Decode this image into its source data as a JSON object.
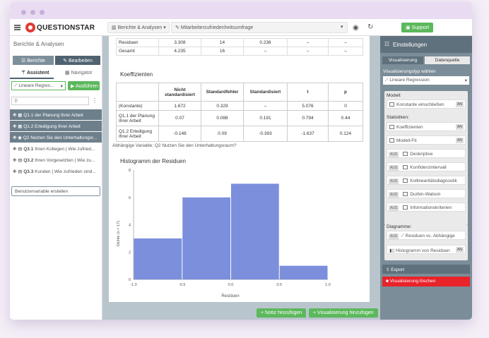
{
  "app": {
    "brand": "QUESTIONSTAR"
  },
  "topbar": {
    "crumb1": "Berichte & Analysen",
    "crumb2": "Mitarbeiterzufriedenheitsumfrage",
    "support": "Support"
  },
  "left": {
    "title": "Berichte & Analysen",
    "btn_reports": "Berichte",
    "btn_edit": "Bearbeiten",
    "tab_assistant": "Assistent",
    "tab_navigator": "Navigator",
    "method": "Lineare Regres...",
    "run": "Ausführen",
    "search_placeholder": "",
    "variables": [
      {
        "code": "Q1.1",
        "label": "der Planung Ihrer Arbeit"
      },
      {
        "code": "Q1.2",
        "label": "Erledigung Ihrer Arbeit"
      },
      {
        "code": "Q2",
        "label": "Nutzen Sie den Unterhaltungsr..."
      },
      {
        "code": "Q3.1",
        "label": "Ihren Kollegen | Wie zufried..."
      },
      {
        "code": "Q3.2",
        "label": "Ihren Vorgesetzten | Wie zu..."
      },
      {
        "code": "Q3.3",
        "label": "Kunden | Wie zufrieden sind..."
      }
    ],
    "create_var": "Benutzervariable erstellen"
  },
  "anova": {
    "rows": [
      {
        "label": "Residuen",
        "ss": "3.308",
        "df": "14",
        "ms": "0.236",
        "f": "–",
        "p": "–"
      },
      {
        "label": "Gesamt",
        "ss": "4.235",
        "df": "16",
        "ms": "–",
        "f": "–",
        "p": "–"
      }
    ]
  },
  "coef": {
    "title": "Koeffizienten",
    "headers": {
      "b": "Nicht standardisiert",
      "se": "Standardfehler",
      "beta": "Standardisiert",
      "t": "t",
      "p": "p"
    },
    "rows": [
      {
        "label": "(Konstante)",
        "b": "1.672",
        "se": "0.329",
        "beta": "–",
        "t": "5.076",
        "p": "0"
      },
      {
        "label": "Q1.1 der Planung Ihrer Arbeit",
        "b": "0.07",
        "se": "0.088",
        "beta": "0.191",
        "t": "0.794",
        "p": "0.44"
      },
      {
        "label": "Q1.2 Erledigung Ihrer Arbeit",
        "b": "-0.148",
        "se": "0.09",
        "beta": "-0.393",
        "t": "-1.637",
        "p": "0.124"
      }
    ],
    "dependent": "Abhängige Variable: Q2 Nutzen Sie den Unterhaltungsraum?"
  },
  "chart_data": {
    "type": "bar",
    "title": "Histogramm der Residuen",
    "xlabel": "Residuen",
    "ylabel": "Dichte (n = 17)",
    "xlim": [
      -1.0,
      1.0
    ],
    "ylim": [
      0,
      8
    ],
    "x_ticks": [
      "-1.0",
      "-0.5",
      "0.0",
      "0.5",
      "1.0"
    ],
    "y_ticks": [
      "0",
      "2",
      "4",
      "6",
      "8"
    ],
    "bins": [
      {
        "x0": -1.0,
        "x1": -0.5,
        "value": 3
      },
      {
        "x0": -0.5,
        "x1": 0.0,
        "value": 6
      },
      {
        "x0": 0.0,
        "x1": 0.5,
        "value": 7
      },
      {
        "x0": 0.5,
        "x1": 1.0,
        "value": 1
      }
    ],
    "color": "#7b8fdc"
  },
  "footer": {
    "add_note": "Notiz hinzufügen",
    "add_vis": "Visualisierung hinzufügen"
  },
  "right": {
    "title": "Einstellungen",
    "tab_vis": "Visualisierung",
    "tab_data": "Datenquelle",
    "vistype_label": "Visualisierungstyp wählen",
    "vistype": "Lineare Regression",
    "model_label": "Modell:",
    "model_items": [
      {
        "label": "Konstante einschließen",
        "badge": "AN"
      }
    ],
    "stats_label": "Statistiken:",
    "stats_items": [
      {
        "label": "Koeffizienten",
        "badge": "AN",
        "pos": "right"
      },
      {
        "label": "Modell-Fit",
        "badge": "AN",
        "pos": "right"
      },
      {
        "label": "Deskriptive",
        "badge": "AUS",
        "pos": "left"
      },
      {
        "label": "Konfidenzintervall",
        "badge": "AUS",
        "pos": "left"
      },
      {
        "label": "Kollinearitätsdiagnostik",
        "badge": "AUS",
        "pos": "left"
      },
      {
        "label": "Durbin-Watson",
        "badge": "AUS",
        "pos": "left"
      },
      {
        "label": "Informationskriterien",
        "badge": "AUS",
        "pos": "left"
      }
    ],
    "diag_label": "Diagramme:",
    "diag_items": [
      {
        "label": "Residuen vs. Abhängige",
        "badge": "AUS",
        "pos": "left"
      },
      {
        "label": "Histogramm von Residuen",
        "badge": "AN",
        "pos": "right"
      }
    ],
    "export": "Export",
    "delete": "Visualisierung löschen"
  }
}
